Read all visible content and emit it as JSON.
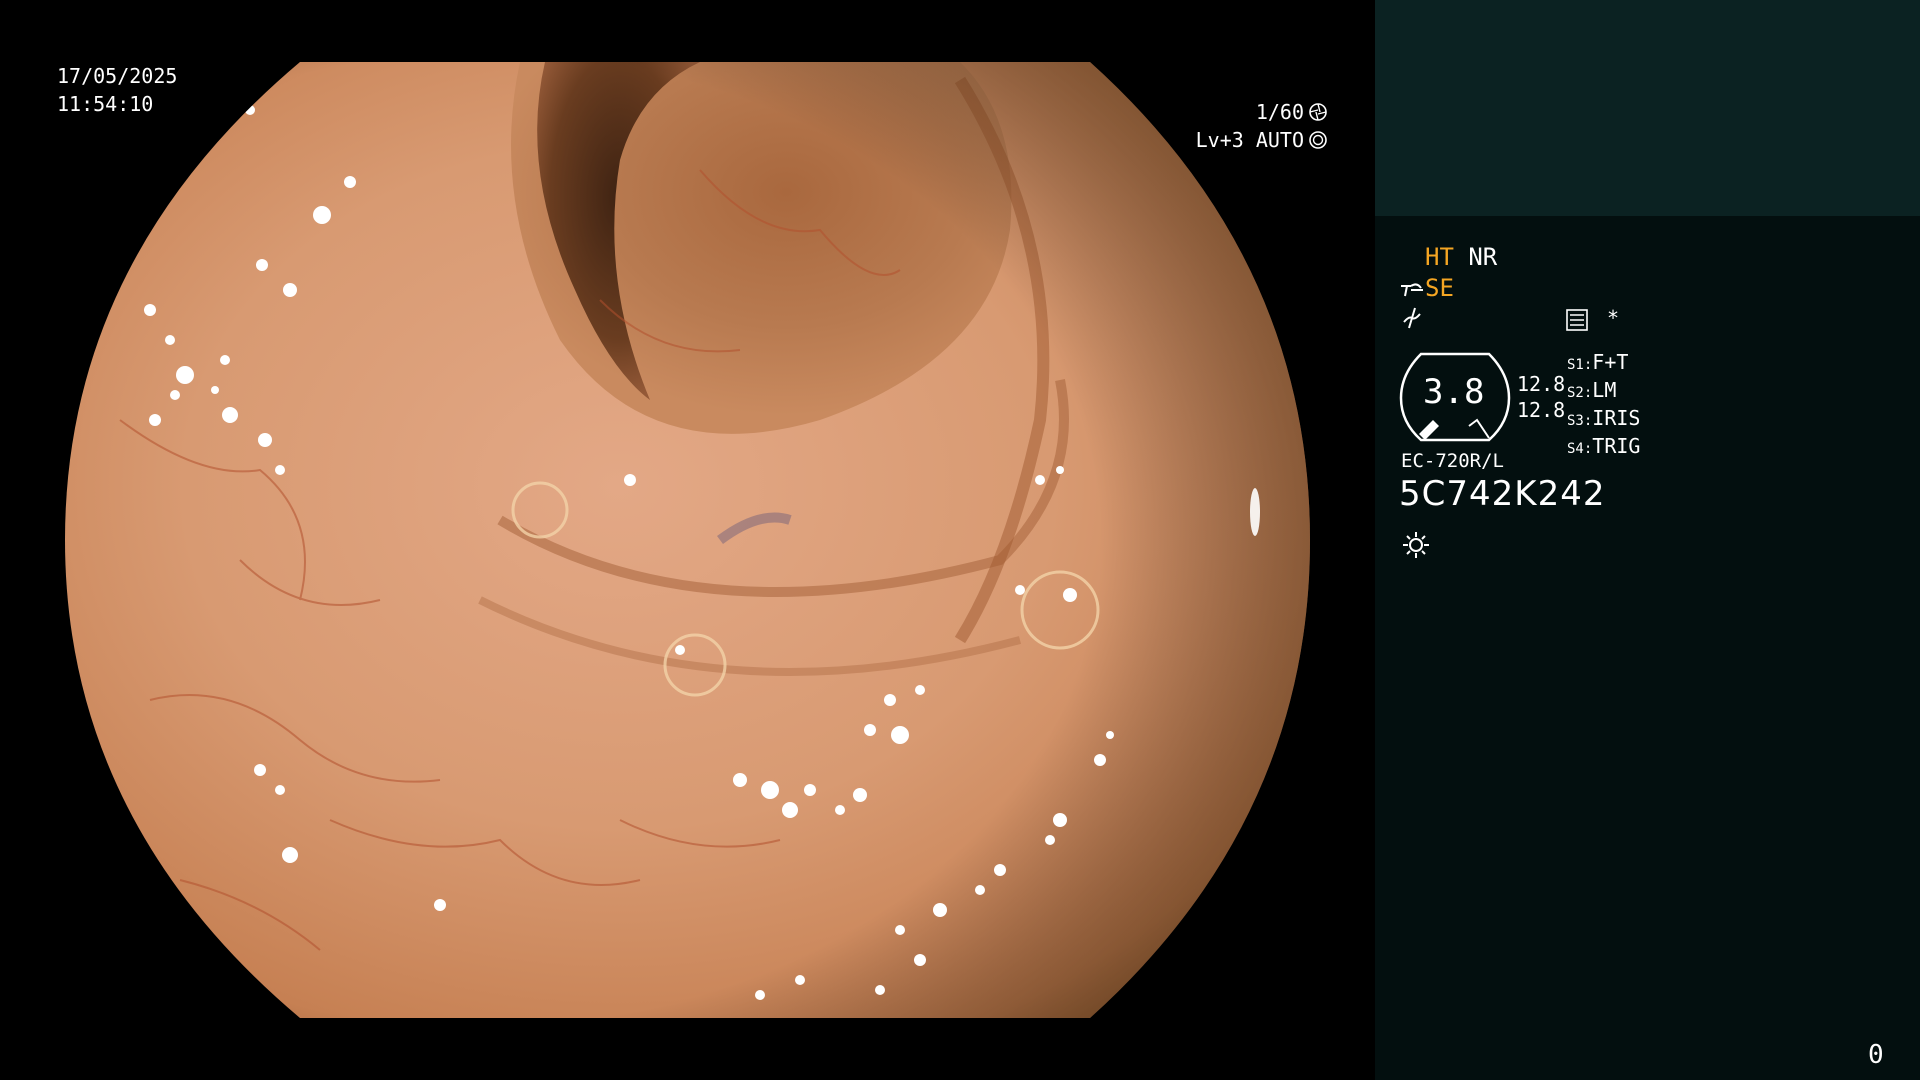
{
  "overlay": {
    "date": "17/05/2025",
    "time": "11:54:10",
    "shutter": "1/60",
    "level": "Lv+3 AUTO"
  },
  "panel": {
    "mode_ht": "HT",
    "mode_nr": "NR",
    "mode_se": "SE",
    "zoom_value": "3.8",
    "ratio_1": "12.8",
    "ratio_2": "12.8",
    "switches": [
      {
        "key": "S1:",
        "value": "F+T"
      },
      {
        "key": "S2:",
        "value": "LM"
      },
      {
        "key": "S3:",
        "value": "IRIS"
      },
      {
        "key": "S4:",
        "value": "TRIG"
      }
    ],
    "asterisk": "*",
    "model": "EC-720R/L",
    "serial": "5C742K242",
    "counter": "0"
  },
  "colors": {
    "panel_bg": "#030f0f",
    "panel_top": "#0b2222",
    "accent": "#f5a623",
    "text": "#ffffff"
  },
  "icons": [
    "aperture-icon",
    "iris-icon",
    "light-scope-icon",
    "wave-icon",
    "settings-list-icon",
    "sun-icon"
  ]
}
